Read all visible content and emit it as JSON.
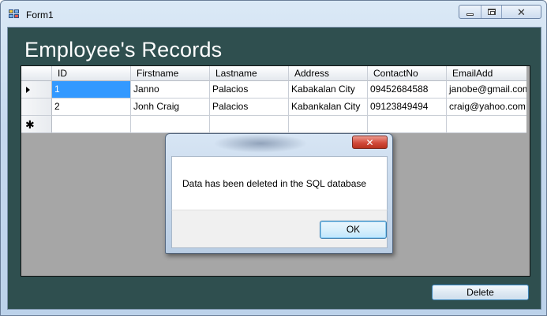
{
  "window": {
    "title": "Form1",
    "controls": {
      "minimize": "minimize",
      "maximize": "maximize",
      "close": "✕"
    }
  },
  "form": {
    "heading": "Employee's Records",
    "delete_label": "Delete"
  },
  "grid": {
    "columns": [
      "ID",
      "Firstname",
      "Lastname",
      "Address",
      "ContactNo",
      "EmailAdd"
    ],
    "rows": [
      [
        "1",
        "Janno",
        "Palacios",
        "Kabakalan City",
        "09452684588",
        "janobe@gmail.com"
      ],
      [
        "2",
        "Jonh Craig",
        "Palacios",
        "Kabankalan City",
        "09123849494",
        "craig@yahoo.com"
      ],
      [
        "",
        "",
        "",
        "",
        "",
        ""
      ]
    ],
    "new_row_marker": "✱"
  },
  "dialog": {
    "message": "Data has been deleted in the SQL database",
    "ok_label": "OK",
    "close_glyph": "✕"
  },
  "colors": {
    "form_background": "#2f4f4f",
    "grid_background": "#a6a6a6",
    "selection": "#3399ff"
  }
}
